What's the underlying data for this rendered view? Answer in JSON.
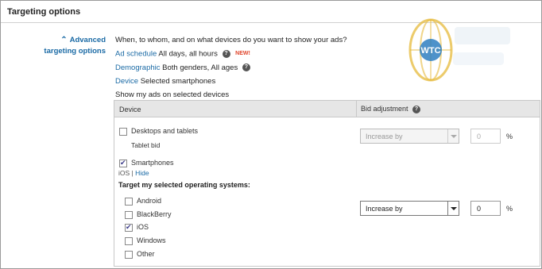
{
  "header": {
    "title": "Targeting options"
  },
  "advanced": {
    "toggle_label": "Advanced targeting options"
  },
  "intro": "When, to whom, and on what devices do you want to show your ads?",
  "ad_schedule": {
    "link": "Ad schedule",
    "value": "All days, all hours",
    "badge": "NEW!"
  },
  "demographic": {
    "link": "Demographic",
    "value": "Both genders, All ages"
  },
  "device": {
    "link": "Device",
    "value": "Selected smartphones"
  },
  "show_on": "Show my ads on selected devices",
  "table": {
    "col_device": "Device",
    "col_bid": "Bid adjustment",
    "desktops": {
      "label": "Desktops and tablets",
      "checked": false,
      "sub": "Tablet bid",
      "bid_mode": "Increase by",
      "bid_value": "0",
      "unit": "%"
    },
    "smartphones": {
      "label": "Smartphones",
      "checked": true,
      "os_current": "iOS",
      "separator": "|",
      "hide_link": "Hide",
      "target_os_label": "Target my selected operating systems:",
      "os_options": [
        {
          "label": "Android",
          "checked": false
        },
        {
          "label": "BlackBerry",
          "checked": false
        },
        {
          "label": "iOS",
          "checked": true
        },
        {
          "label": "Windows",
          "checked": false
        },
        {
          "label": "Other",
          "checked": false
        }
      ],
      "bid_mode": "Increase by",
      "bid_value": "0",
      "unit": "%"
    }
  },
  "watermark": {
    "logo_text": "WTC"
  },
  "colors": {
    "link": "#1a6aa5",
    "badge": "#e0452b",
    "header_bg": "#e6e6e6"
  }
}
